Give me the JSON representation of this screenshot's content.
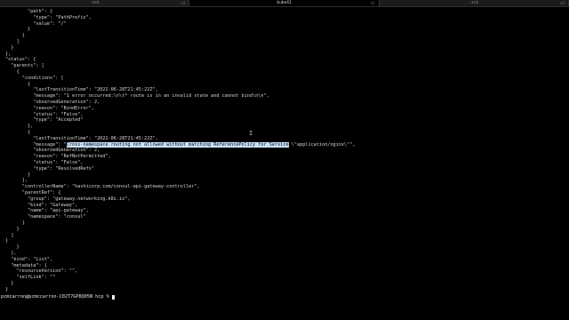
{
  "tabs": [
    {
      "label": "-zsh",
      "shortcut": "⌘1",
      "active": false
    },
    {
      "label": "kube41",
      "shortcut": "⌘2",
      "active": true
    },
    {
      "label": "-zsh",
      "shortcut": "⌘3",
      "active": false
    }
  ],
  "terminal": {
    "lines": [
      "        \"path\": {",
      "          \"type\": \"PathPrefix\",",
      "          \"value\": \"/\"",
      "        }",
      "      }",
      "    ]",
      "  }",
      "},",
      "\"status\": {",
      "  \"parents\": [",
      "    {",
      "      \"conditions\": [",
      "        {",
      "          \"lastTransitionTime\": \"2022-06-28T21:45:22Z\",",
      "          \"message\": \"1 error occurred:\\n\\t* route is in an invalid state and cannot bind\\n\\n\",",
      "          \"observedGeneration\": 2,",
      "          \"reason\": \"BindError\",",
      "          \"status\": \"False\",",
      "          \"type\": \"Accepted\"",
      "        },",
      "        {",
      "          \"lastTransitionTime\": \"2022-06-28T21:45:22Z\",",
      "          \"message\": \"Cross-namespace routing not allowed without matching ReferencePolicy for Service \\\"application/nginx\\\"\",",
      "          \"observedGeneration\": 2,",
      "          \"reason\": \"RefNotPermitted\",",
      "          \"status\": \"False\",",
      "          \"type\": \"ResolvedRefs\"",
      "        }",
      "      ],",
      "      \"controllerName\": \"hashicorp.com/consul-api-gateway-controller\",",
      "      \"parentRef\": {",
      "        \"group\": \"gateway.networking.k8s.io\",",
      "        \"kind\": \"Gateway\",",
      "        \"name\": \"api-gateway\",",
      "        \"namespace\": \"consul\"",
      "      }",
      "    }",
      "  ]",
      "}",
      "    }",
      "  ],",
      "  \"kind\": \"List\",",
      "  \"metadata\": {",
      "    \"resourceVersion\": \"\",",
      "    \"selfLink\": \"\"",
      "  }",
      "}"
    ],
    "selected_message": {
      "prefix": "          \"message\": \"",
      "selected": "Cross-namespace routing not allowed without matching ReferencePolicy for Service",
      "suffix": " \\\"application/nginx\\\"\","
    },
    "prompt": "pcmcarron@pcmccarron-C02T7GP8Q05N hcp % "
  }
}
